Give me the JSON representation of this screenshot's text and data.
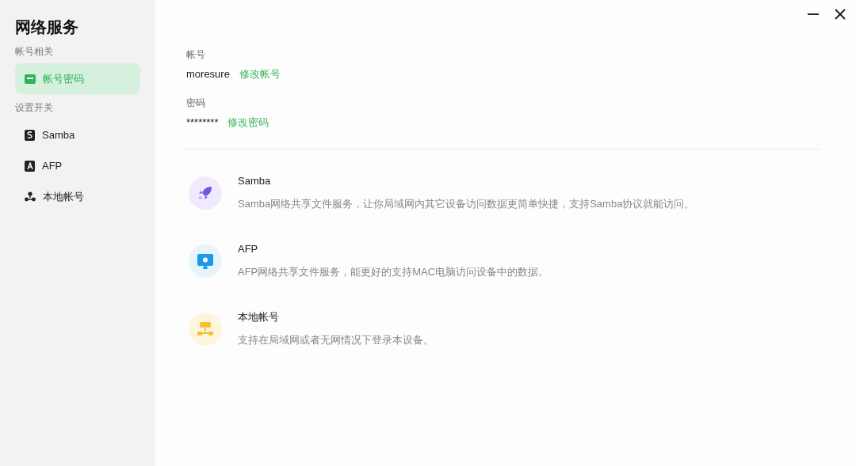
{
  "sidebar": {
    "title": "网络服务",
    "groups": [
      {
        "heading": "帐号相关",
        "items": [
          {
            "label": "帐号密码",
            "kind": "card",
            "selected": true
          }
        ]
      },
      {
        "heading": "设置开关",
        "items": [
          {
            "label": "Samba",
            "kind": "samba",
            "selected": false
          },
          {
            "label": "AFP",
            "kind": "afp",
            "selected": false
          },
          {
            "label": "本地帐号",
            "kind": "local",
            "selected": false
          }
        ]
      }
    ]
  },
  "account": {
    "fields": [
      {
        "label": "帐号",
        "value": "moresure",
        "action": "修改帐号"
      },
      {
        "label": "密码",
        "value": "********",
        "action": "修改密码"
      }
    ]
  },
  "services": [
    {
      "kind": "samba",
      "title": "Samba",
      "description": "Samba网络共享文件服务，让你局域网内其它设备访问数据更简单快捷，支持Samba协议就能访问。"
    },
    {
      "kind": "afp",
      "title": "AFP",
      "description": "AFP网络共享文件服务，能更好的支持MAC电脑访问设备中的数据。"
    },
    {
      "kind": "local",
      "title": "本地帐号",
      "description": "支持在局域网或者无网情况下登录本设备。"
    }
  ]
}
